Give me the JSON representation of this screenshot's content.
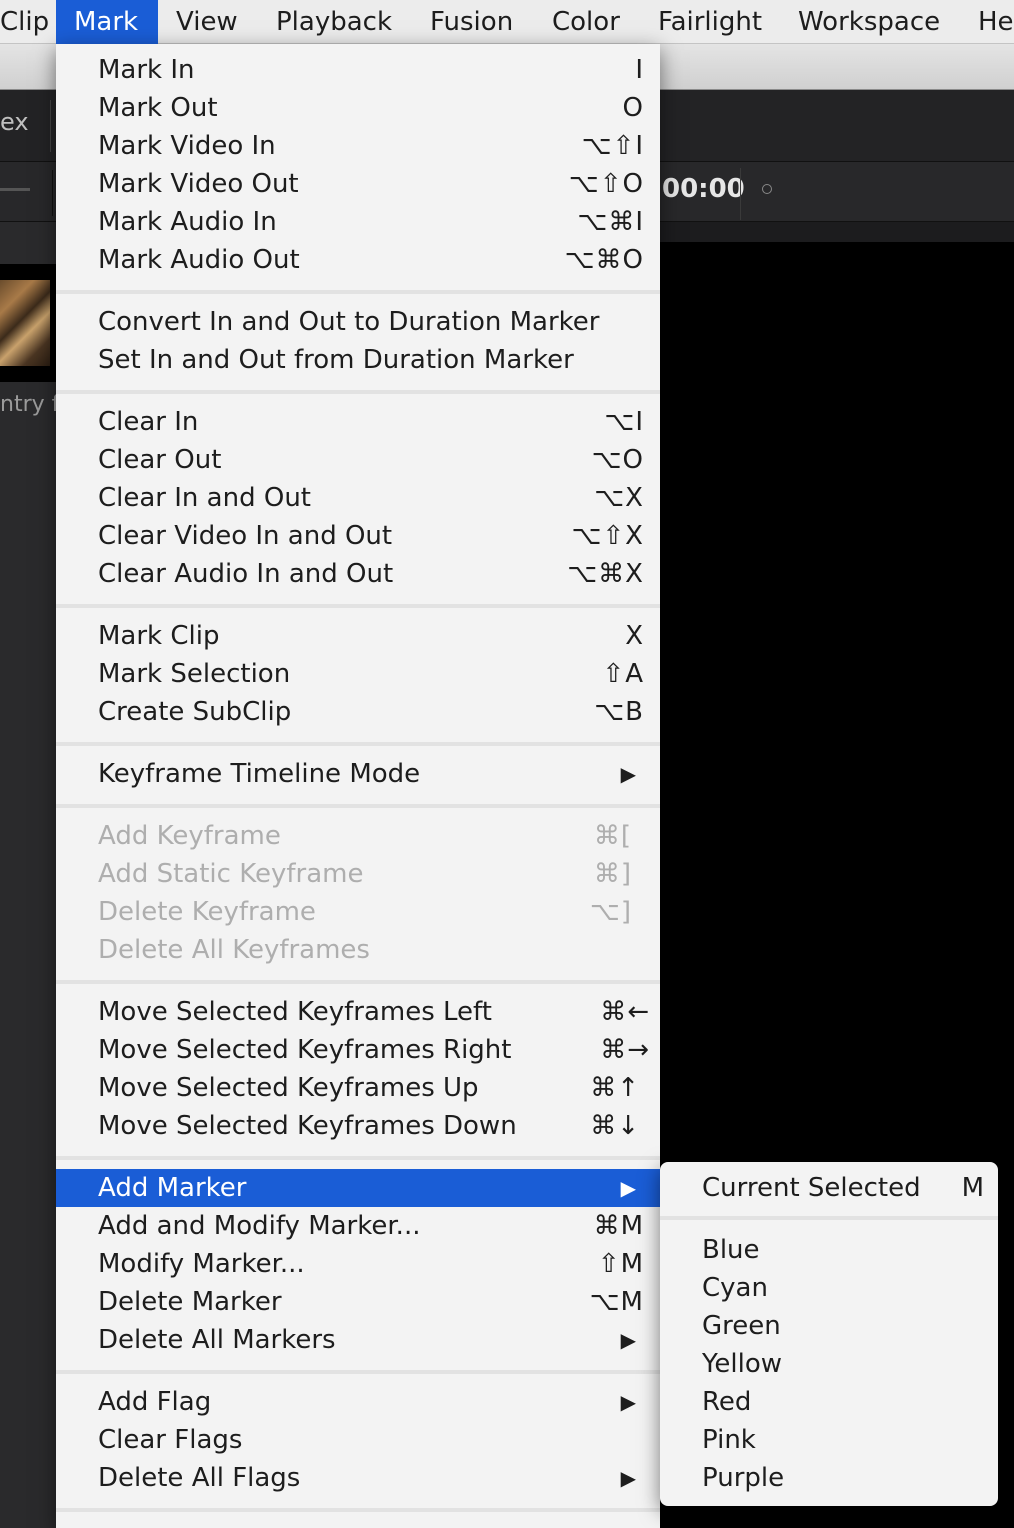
{
  "menubar": {
    "items": [
      {
        "label": "Clip"
      },
      {
        "label": "Mark"
      },
      {
        "label": "View"
      },
      {
        "label": "Playback"
      },
      {
        "label": "Fusion"
      },
      {
        "label": "Color"
      },
      {
        "label": "Fairlight"
      },
      {
        "label": "Workspace"
      },
      {
        "label": "He"
      }
    ]
  },
  "background": {
    "left_text": "ex",
    "timecode": "00:00",
    "entry_text": "ntry f"
  },
  "menu": {
    "items": [
      {
        "label": "Mark In",
        "shortcut": "I"
      },
      {
        "label": "Mark Out",
        "shortcut": "O"
      },
      {
        "label": "Mark Video In",
        "shortcut": "⌥⇧I"
      },
      {
        "label": "Mark Video Out",
        "shortcut": "⌥⇧O"
      },
      {
        "label": "Mark Audio In",
        "shortcut": "⌥⌘I"
      },
      {
        "label": "Mark Audio Out",
        "shortcut": "⌥⌘O"
      },
      {
        "label": "Convert In and Out to Duration Marker",
        "shortcut": ""
      },
      {
        "label": "Set In and Out from Duration Marker",
        "shortcut": ""
      },
      {
        "label": "Clear In",
        "shortcut": "⌥I"
      },
      {
        "label": "Clear Out",
        "shortcut": "⌥O"
      },
      {
        "label": "Clear In and Out",
        "shortcut": "⌥X"
      },
      {
        "label": "Clear Video In and Out",
        "shortcut": "⌥⇧X"
      },
      {
        "label": "Clear Audio In and Out",
        "shortcut": "⌥⌘X"
      },
      {
        "label": "Mark Clip",
        "shortcut": "X"
      },
      {
        "label": "Mark Selection",
        "shortcut": "⇧A"
      },
      {
        "label": "Create SubClip",
        "shortcut": "⌥B"
      },
      {
        "label": "Keyframe Timeline Mode",
        "shortcut": "▶"
      },
      {
        "label": "Add Keyframe",
        "shortcut": "⌘["
      },
      {
        "label": "Add Static Keyframe",
        "shortcut": "⌘]"
      },
      {
        "label": "Delete Keyframe",
        "shortcut": "⌥]"
      },
      {
        "label": "Delete All Keyframes",
        "shortcut": ""
      },
      {
        "label": "Move Selected Keyframes Left",
        "shortcut": "⌘←"
      },
      {
        "label": "Move Selected Keyframes Right",
        "shortcut": "⌘→"
      },
      {
        "label": "Move Selected Keyframes Up",
        "shortcut": "⌘↑"
      },
      {
        "label": "Move Selected Keyframes Down",
        "shortcut": "⌘↓"
      },
      {
        "label": "Add Marker",
        "shortcut": "▶"
      },
      {
        "label": "Add and Modify Marker...",
        "shortcut": "⌘M"
      },
      {
        "label": "Modify Marker...",
        "shortcut": "⇧M"
      },
      {
        "label": "Delete Marker",
        "shortcut": "⌥M"
      },
      {
        "label": "Delete All Markers",
        "shortcut": "▶"
      },
      {
        "label": "Add Flag",
        "shortcut": "▶"
      },
      {
        "label": "Clear Flags",
        "shortcut": ""
      },
      {
        "label": "Delete All Flags",
        "shortcut": "▶"
      }
    ]
  },
  "submenu": {
    "current": {
      "label": "Current Selected",
      "shortcut": "M"
    },
    "colors": [
      {
        "label": "Blue"
      },
      {
        "label": "Cyan"
      },
      {
        "label": "Green"
      },
      {
        "label": "Yellow"
      },
      {
        "label": "Red"
      },
      {
        "label": "Pink"
      },
      {
        "label": "Purple"
      }
    ]
  },
  "colors": {
    "highlight": "#1a5dd6",
    "menu_background": "#f3f3f3",
    "disabled_text": "#aeaeae"
  }
}
